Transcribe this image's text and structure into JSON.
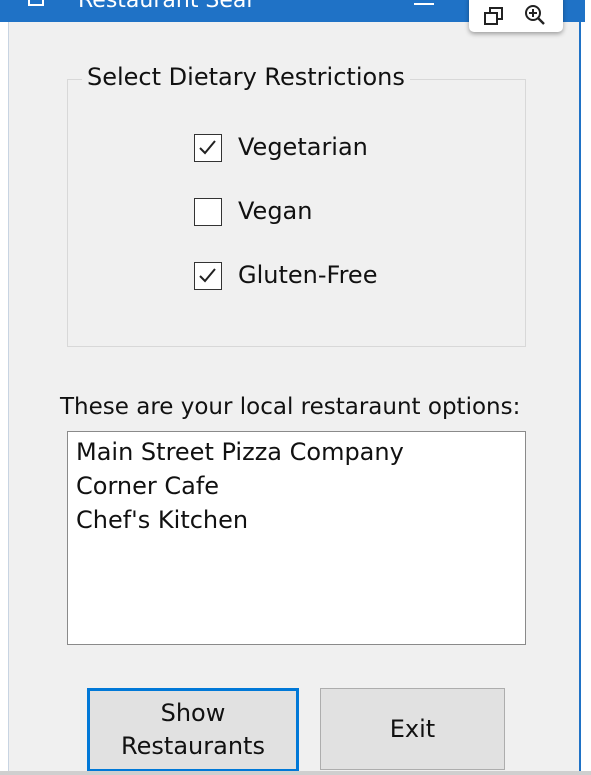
{
  "window": {
    "title": "Restaurant Sear",
    "accent_color": "#1f72c6",
    "controls": [
      "minimize-icon",
      "restore-icon",
      "zoom-in-icon"
    ]
  },
  "dietary": {
    "group_title": "Select Dietary Restrictions",
    "options": [
      {
        "label": "Vegetarian",
        "checked": true
      },
      {
        "label": "Vegan",
        "checked": false
      },
      {
        "label": "Gluten-Free",
        "checked": true
      }
    ]
  },
  "restaurants": {
    "caption": "These are your local restaraunt options:",
    "items": [
      "Main Street Pizza Company",
      "Corner Cafe",
      "Chef's Kitchen"
    ]
  },
  "buttons": {
    "show_line1": "Show",
    "show_line2": "Restaurants",
    "exit": "Exit",
    "focus_color": "#0078d7"
  }
}
